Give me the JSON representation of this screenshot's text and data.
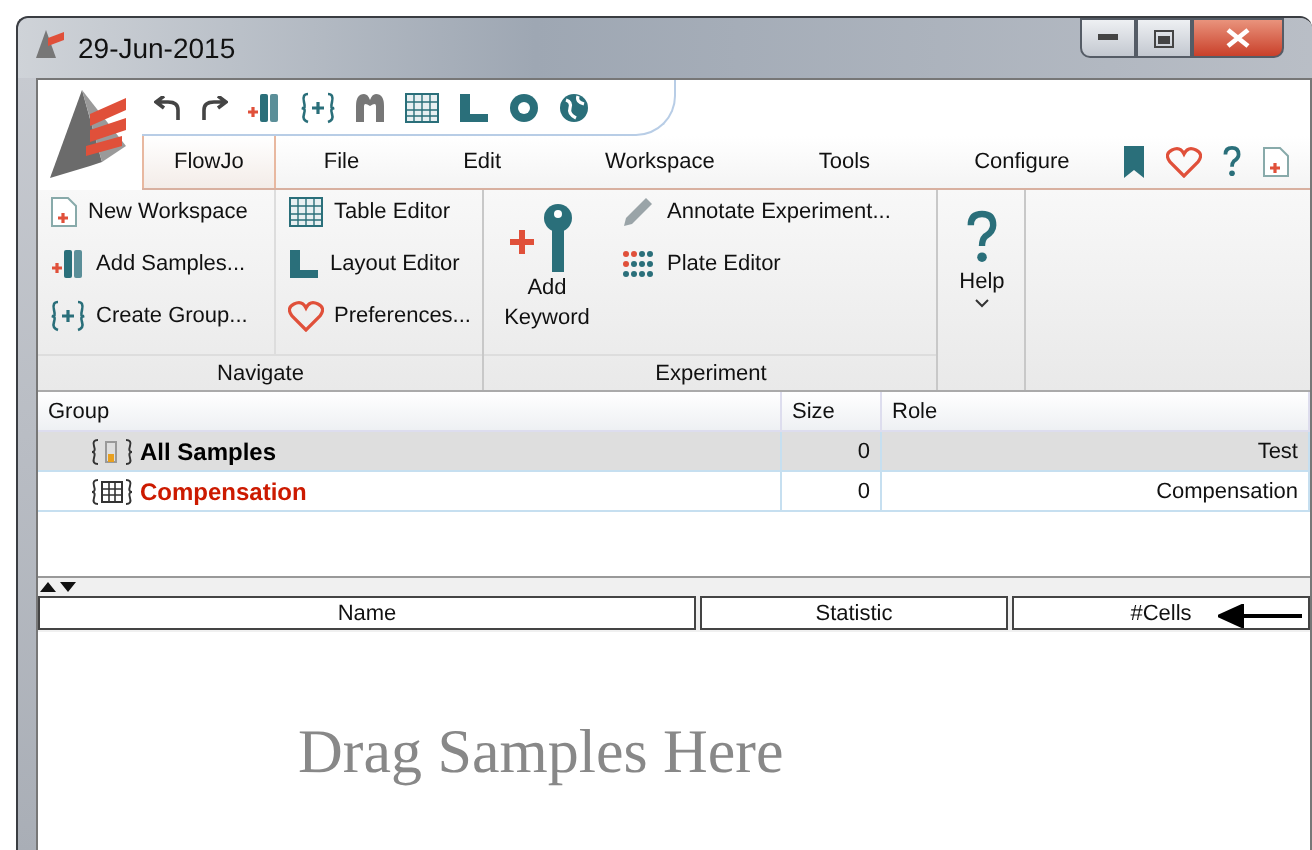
{
  "window": {
    "title": "29-Jun-2015"
  },
  "menu": [
    {
      "label": "FlowJo",
      "selected": true
    },
    {
      "label": "File",
      "selected": false
    },
    {
      "label": "Edit",
      "selected": false
    },
    {
      "label": "Workspace",
      "selected": false
    },
    {
      "label": "Tools",
      "selected": false
    },
    {
      "label": "Configure",
      "selected": false
    }
  ],
  "ribbon": {
    "navigate": {
      "title": "Navigate",
      "items": [
        "New Workspace",
        "Add Samples...",
        "Create Group...",
        "Table Editor",
        "Layout Editor",
        "Preferences..."
      ]
    },
    "experiment": {
      "title": "Experiment",
      "large_item": "Add Keyword",
      "items": [
        "Annotate Experiment...",
        "Plate Editor"
      ]
    },
    "help": {
      "label": "Help"
    }
  },
  "groups": {
    "columns": [
      "Group",
      "Size",
      "Role"
    ],
    "rows": [
      {
        "name": "All Samples",
        "size": "0",
        "role": "Test",
        "selected": true,
        "color": "#000000"
      },
      {
        "name": "Compensation",
        "size": "0",
        "role": "Compensation",
        "selected": false,
        "color": "#cc1a00"
      }
    ]
  },
  "samples": {
    "columns": [
      "Name",
      "Statistic",
      "#Cells"
    ],
    "placeholder": "Drag Samples Here"
  }
}
